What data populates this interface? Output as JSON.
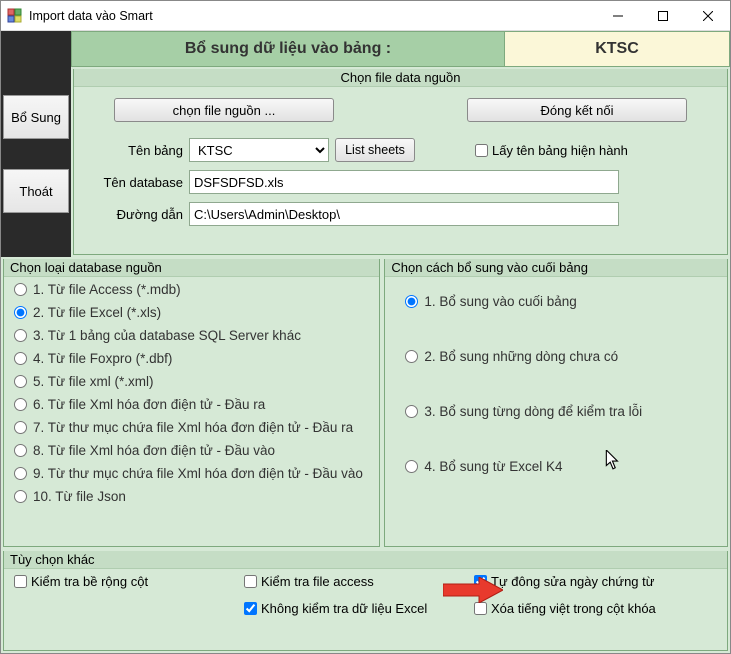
{
  "window": {
    "title": "Import data vào Smart"
  },
  "header": {
    "heading1": "Bổ sung dữ liệu vào bảng :",
    "heading2": "KTSC"
  },
  "sidebar": {
    "add_btn": "Bổ Sung",
    "exit_btn": "Thoát"
  },
  "filegroup": {
    "legend": "Chọn file data nguồn",
    "choose_file_btn": "chọn file nguồn ...",
    "close_conn_btn": "Đóng kết nối",
    "table_label": "Tên bảng",
    "table_value": "KTSC",
    "list_sheets_btn": "List sheets",
    "get_current_table": "Lấy tên bảng hiện hành",
    "db_label": "Tên database",
    "db_value": "DSFSDFSD.xls",
    "path_label": "Đường dẫn",
    "path_value": "C:\\Users\\Admin\\Desktop\\"
  },
  "source_group": {
    "legend": "Chọn loại database nguồn",
    "options": [
      "1. Từ file Access (*.mdb)",
      "2. Từ file Excel (*.xls)",
      "3. Từ 1 bảng của database SQL Server khác",
      "4. Từ file Foxpro (*.dbf)",
      "5. Từ file xml (*.xml)",
      "6. Từ file Xml hóa đơn điện tử - Đầu ra",
      "7. Từ thư mục chứa file Xml hóa đơn điện tử - Đầu ra",
      "8. Từ file Xml hóa đơn điện tử - Đầu vào",
      "9. Từ thư mục chứa file Xml hóa đơn điện tử - Đầu vào",
      "10. Từ file Json"
    ],
    "selected_index": 1
  },
  "append_group": {
    "legend": "Chọn cách bổ sung vào cuối bảng",
    "options": [
      "1. Bổ sung vào cuối bảng",
      "2. Bổ sung những dòng chưa có",
      "3. Bổ sung từng dòng để kiểm tra lỗi",
      "4. Bổ sung từ Excel K4"
    ],
    "selected_index": 0
  },
  "other_group": {
    "legend": "Tùy chọn khác",
    "checks": {
      "col_width": {
        "label": "Kiểm tra bề rộng cột",
        "checked": false
      },
      "file_access": {
        "label": "Kiểm tra file access",
        "checked": false
      },
      "auto_date": {
        "label": "Tự đông sửa ngày chứng từ",
        "checked": true
      },
      "no_excel_check": {
        "label": "Không kiểm tra dữ liệu Excel",
        "checked": true
      },
      "strip_vn": {
        "label": "Xóa tiếng việt trong cột khóa",
        "checked": false
      }
    }
  }
}
